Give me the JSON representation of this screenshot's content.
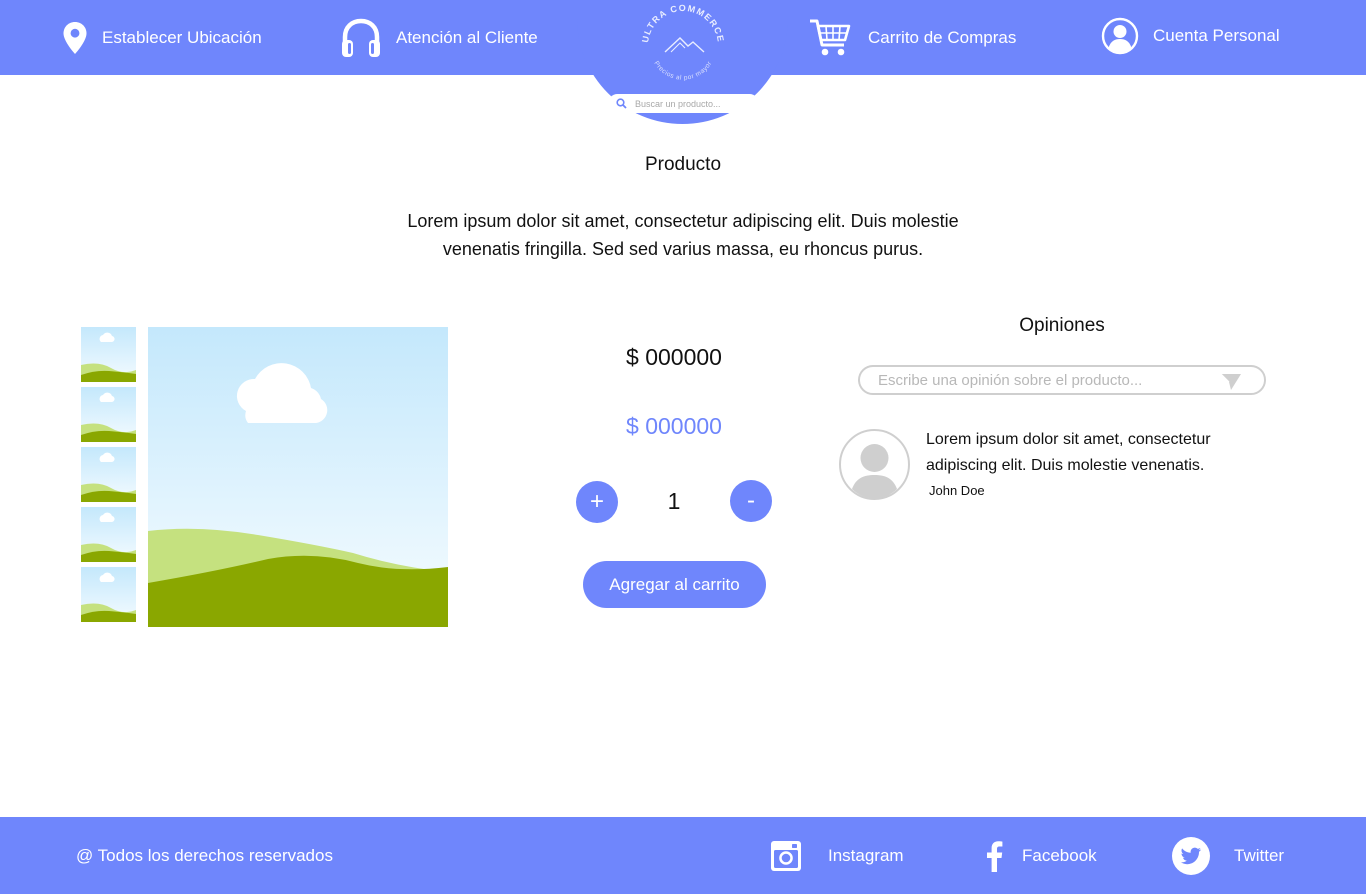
{
  "header": {
    "location_label": "Establecer Ubicación",
    "support_label": "Atención al Cliente",
    "cart_label": "Carrito de Compras",
    "account_label": "Cuenta Personal",
    "logo_text_top": "ULTRA COMMERCE",
    "logo_text_bottom": "Precios al por mayor",
    "search_placeholder": "Buscar un producto..."
  },
  "product": {
    "title": "Producto",
    "description": "Lorem ipsum dolor sit amet, consectetur adipiscing elit. Duis molestie venenatis fringilla. Sed sed varius massa, eu rhoncus purus.",
    "price_regular": "$ 000000",
    "price_offer": "$ 000000",
    "quantity": "1",
    "plus_label": "+",
    "minus_label": "-",
    "add_to_cart_label": "Agregar al carrito"
  },
  "opinions": {
    "title": "Opiniones",
    "input_placeholder": "Escribe una opinión sobre el producto...",
    "reviews": [
      {
        "text": "Lorem ipsum dolor sit amet, consectetur adipiscing elit. Duis molestie venenatis.",
        "author": "John Doe"
      }
    ]
  },
  "footer": {
    "copyright": "@ Todos los derechos reservados",
    "instagram_label": "Instagram",
    "facebook_label": "Facebook",
    "twitter_label": "Twitter"
  },
  "colors": {
    "accent": "#6f86fc",
    "sky": "#c7eafc",
    "grass_light": "#c5e17f",
    "grass_dark": "#8aa700"
  },
  "icons": {
    "location": "location-pin-icon",
    "support": "headphones-icon",
    "cart": "shopping-cart-icon",
    "account": "user-circle-icon",
    "search": "search-icon",
    "send": "send-icon",
    "instagram": "instagram-icon",
    "facebook": "facebook-icon",
    "twitter": "twitter-icon"
  }
}
